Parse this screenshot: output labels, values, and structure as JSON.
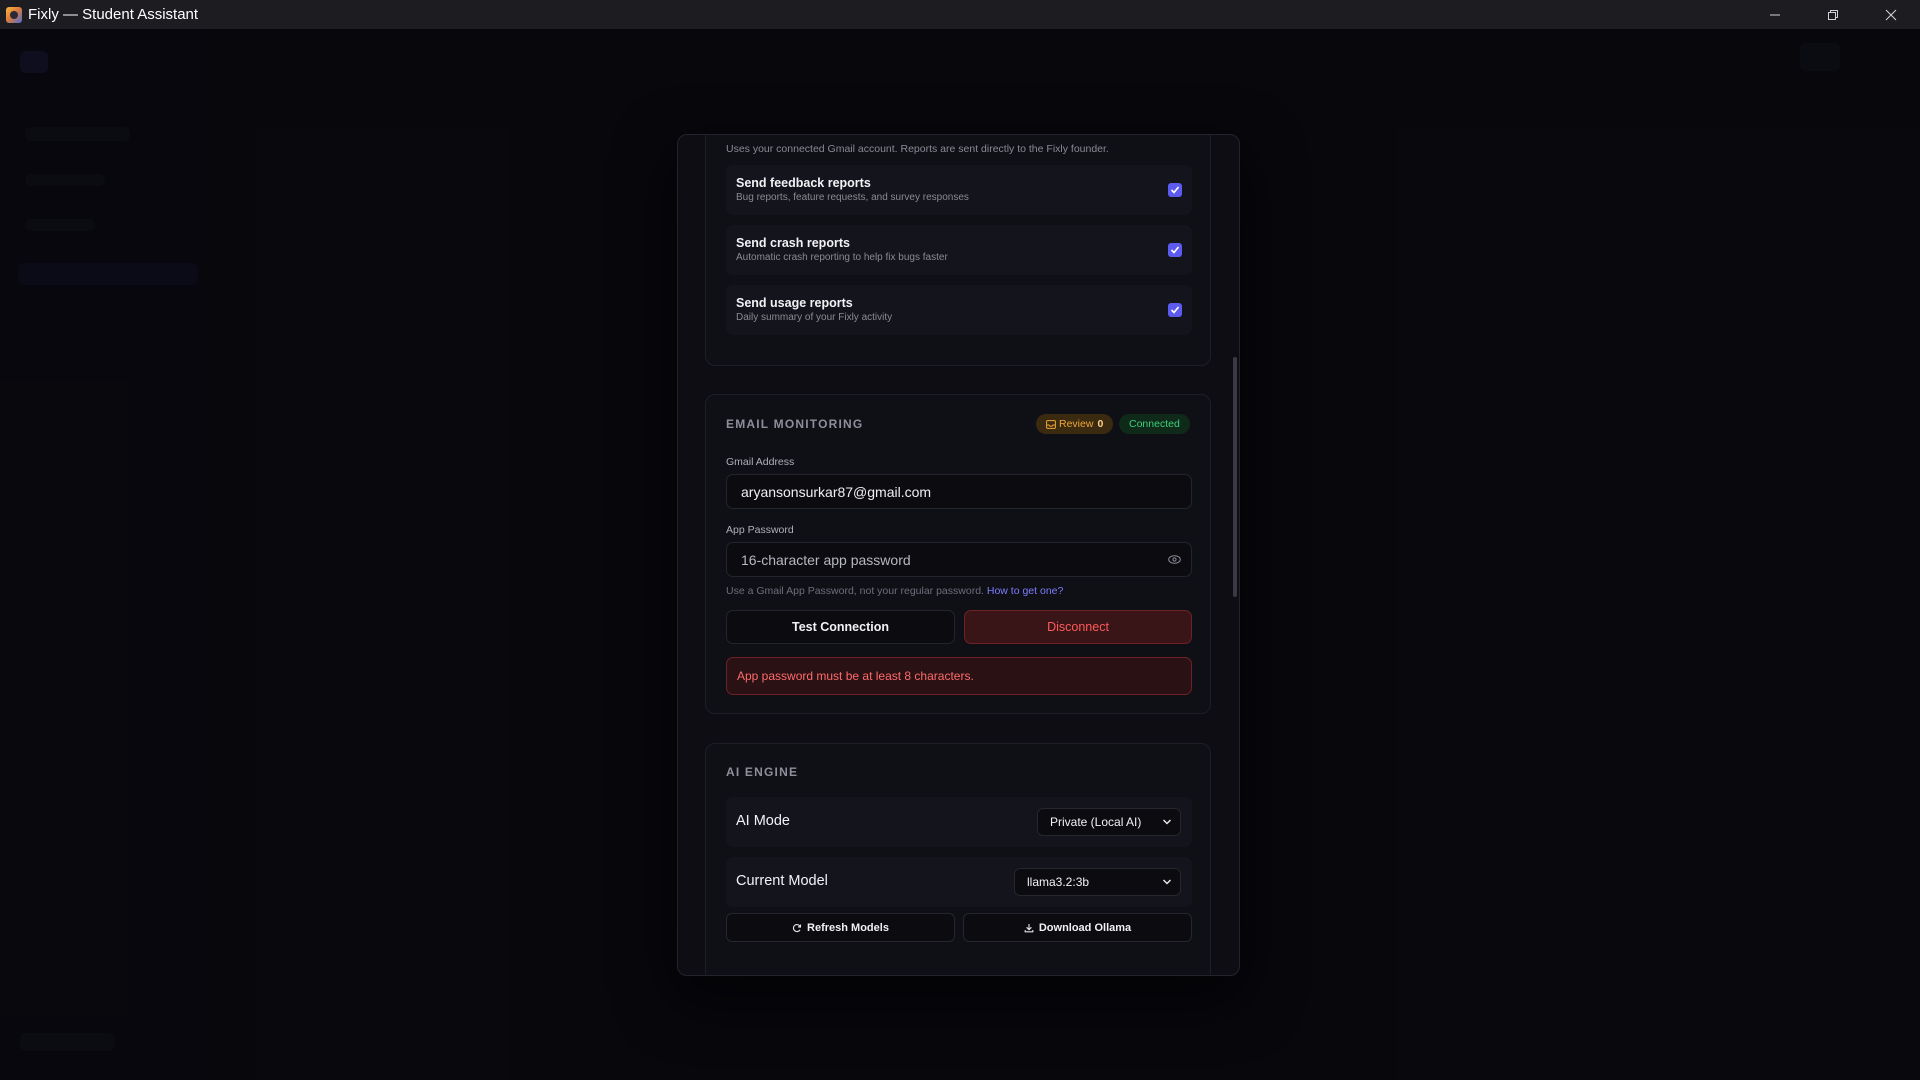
{
  "window": {
    "title": "Fixly — Student Assistant"
  },
  "notifications_card": {
    "note": "Uses your connected Gmail account. Reports are sent directly to the Fixly founder.",
    "rows": [
      {
        "title": "Send feedback reports",
        "subtitle": "Bug reports, feature requests, and survey responses",
        "checked": true
      },
      {
        "title": "Send crash reports",
        "subtitle": "Automatic crash reporting to help fix bugs faster",
        "checked": true
      },
      {
        "title": "Send usage reports",
        "subtitle": "Daily summary of your Fixly activity",
        "checked": true
      }
    ]
  },
  "email_monitoring": {
    "title": "EMAIL MONITORING",
    "review_badge_label": "Review",
    "review_count": "0",
    "status_badge": "Connected",
    "gmail_label": "Gmail Address",
    "gmail_value": "aryansonsurkar87@gmail.com",
    "password_label": "App Password",
    "password_placeholder": "16-character app password",
    "hint_text": "Use a Gmail App Password, not your regular password.",
    "hint_link": "How to get one?",
    "test_button": "Test Connection",
    "disconnect_button": "Disconnect",
    "error": "App password must be at least 8 characters."
  },
  "ai_engine": {
    "title": "AI ENGINE",
    "mode_label": "AI Mode",
    "mode_value": "Private (Local AI)",
    "model_label": "Current Model",
    "model_value": "llama3.2:3b",
    "refresh_button": "Refresh Models",
    "download_button": "Download Ollama"
  },
  "colors": {
    "accent": "#5b5bf0",
    "danger": "#ff5a5a",
    "success": "#3fcf7a",
    "warning": "#f0a63a"
  }
}
